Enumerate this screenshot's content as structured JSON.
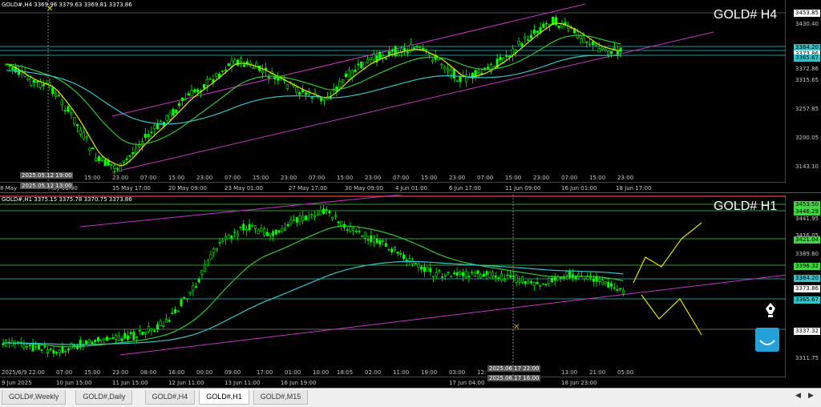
{
  "top_panel": {
    "symbol": "GOLD# H4",
    "header": "GOLD#,H4  3369.96 3379.63 3369.81 3373.86",
    "price_ticks": [
      "3430.40",
      "3372.86",
      "3315.65",
      "3257.85",
      "3200.05",
      "3143.10"
    ],
    "price_tags": [
      {
        "label": "3453.85",
        "bg": "#ffffff"
      },
      {
        "label": "3384.20",
        "bg": "#36c3c7"
      },
      {
        "label": "3373.86",
        "bg": "#ffffff"
      },
      {
        "label": "3365.67",
        "bg": "#36c3c7"
      }
    ],
    "time_labels": [
      "8 May",
      "May 01:00",
      "15 May 17:00",
      "20 May 09:00",
      "23 May 01:00",
      "27 May 17:00",
      "30 May 09:00",
      "4 Jun 01:00",
      "6 Jun 17:00",
      "11 Jun 09:00",
      "16 Jun 01:00",
      "18 Jun 17:00"
    ],
    "crosshair_labels": [
      "2025.05.12 19:00",
      "2025.05.12 13:00"
    ],
    "hour_labels": [
      "15:00",
      "23:00",
      "07:00",
      "15:00",
      "23:00",
      "07:00",
      "15:00",
      "23:00",
      "07:00",
      "15:00",
      "23:00",
      "07:00",
      "15:00",
      "23:00",
      "07:00",
      "15:00",
      "23:00",
      "07:00",
      "15:00",
      "23:00"
    ]
  },
  "bottom_panel": {
    "symbol": "GOLD# H1",
    "header": "GOLD#,H1  3375.15 3375.78 3370.75 3373.86",
    "price_ticks": [
      "3441.95",
      "3416.05",
      "3389.80",
      "3311.75"
    ],
    "price_tags": [
      {
        "label": "3453.50",
        "bg": "#46d246"
      },
      {
        "label": "3446.29",
        "bg": "#46d246"
      },
      {
        "label": "3421.04",
        "bg": "#46d246"
      },
      {
        "label": "3396.32",
        "bg": "#46d246"
      },
      {
        "label": "3384.20",
        "bg": "#36c3c7"
      },
      {
        "label": "3373.86",
        "bg": "#ffffff"
      },
      {
        "label": "3365.67",
        "bg": "#36c3c7"
      },
      {
        "label": "3337.32",
        "bg": "#ffffff"
      }
    ],
    "time_labels": [
      "9 Jun 2025",
      "10 Jun 15:00",
      "11 Jun 15:00",
      "12 Jun 11:00",
      "13 Jun 11:00",
      "16 Jun 19:00",
      "17 Jun 04:00",
      "18 Jun 23:00"
    ],
    "crosshair_labels": [
      "2025.06.17 22:00",
      "2025.06.17 16:00"
    ],
    "hour_labels": [
      "2025/6/9 22:00",
      "07:00",
      "15:00",
      "23:00",
      "08:00",
      "16:00",
      "00:00",
      "09:00",
      "17:00",
      "01:00",
      "10:00",
      "18:05",
      "02:00",
      "11:00",
      "19:00",
      "03:00",
      "12:",
      "13:00",
      "21:00",
      "05:00"
    ]
  },
  "tabs": [
    "GOLD#,Weekly",
    "GOLD#,Daily",
    "GOLD#,H4",
    "GOLD#,H1",
    "GOLD#,M15"
  ],
  "active_tab": "GOLD#,H1",
  "colors": {
    "bull": "#00ff00",
    "bear": "#000000",
    "ma_yellow": "#e6e600",
    "ma_green": "#32c832",
    "ma_cyan": "#36c3c7",
    "channel": "#c832c8"
  }
}
